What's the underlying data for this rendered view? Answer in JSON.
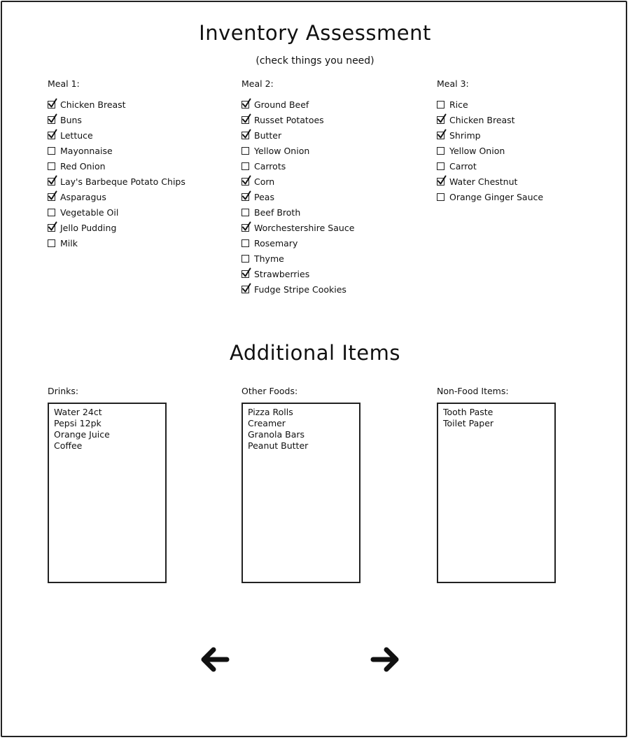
{
  "header": {
    "title": "Inventory Assessment",
    "subtitle": "(check things you need)"
  },
  "meals": [
    {
      "label": "Meal 1:",
      "items": [
        {
          "label": "Chicken Breast",
          "checked": true
        },
        {
          "label": "Buns",
          "checked": true
        },
        {
          "label": "Lettuce",
          "checked": true
        },
        {
          "label": "Mayonnaise",
          "checked": false
        },
        {
          "label": "Red Onion",
          "checked": false
        },
        {
          "label": "Lay's Barbeque Potato Chips",
          "checked": true
        },
        {
          "label": "Asparagus",
          "checked": true
        },
        {
          "label": "Vegetable Oil",
          "checked": false
        },
        {
          "label": "Jello Pudding",
          "checked": true
        },
        {
          "label": "Milk",
          "checked": false
        }
      ]
    },
    {
      "label": "Meal 2:",
      "items": [
        {
          "label": "Ground Beef",
          "checked": true
        },
        {
          "label": "Russet Potatoes",
          "checked": true
        },
        {
          "label": "Butter",
          "checked": true
        },
        {
          "label": "Yellow Onion",
          "checked": false
        },
        {
          "label": "Carrots",
          "checked": false
        },
        {
          "label": "Corn",
          "checked": true
        },
        {
          "label": "Peas",
          "checked": true
        },
        {
          "label": "Beef Broth",
          "checked": false
        },
        {
          "label": "Worchestershire Sauce",
          "checked": true
        },
        {
          "label": "Rosemary",
          "checked": false
        },
        {
          "label": "Thyme",
          "checked": false
        },
        {
          "label": "Strawberries",
          "checked": true
        },
        {
          "label": "Fudge Stripe Cookies",
          "checked": true
        }
      ]
    },
    {
      "label": "Meal 3:",
      "items": [
        {
          "label": "Rice",
          "checked": false
        },
        {
          "label": "Chicken Breast",
          "checked": true
        },
        {
          "label": "Shrimp",
          "checked": true
        },
        {
          "label": "Yellow Onion",
          "checked": false
        },
        {
          "label": "Carrot",
          "checked": false
        },
        {
          "label": "Water Chestnut",
          "checked": true
        },
        {
          "label": "Orange Ginger Sauce",
          "checked": false
        }
      ]
    }
  ],
  "additional": {
    "title": "Additional Items",
    "lists": [
      {
        "label": "Drinks:",
        "entries": [
          "Water 24ct",
          "Pepsi 12pk",
          "Orange Juice",
          "Coffee"
        ]
      },
      {
        "label": "Other Foods:",
        "entries": [
          "Pizza Rolls",
          "Creamer",
          "Granola Bars",
          "Peanut Butter"
        ]
      },
      {
        "label": "Non-Food Items:",
        "entries": [
          "Tooth Paste",
          "Toilet Paper"
        ]
      }
    ]
  },
  "navigation": {
    "back_icon": "arrow-left-icon",
    "next_icon": "arrow-right-icon"
  }
}
